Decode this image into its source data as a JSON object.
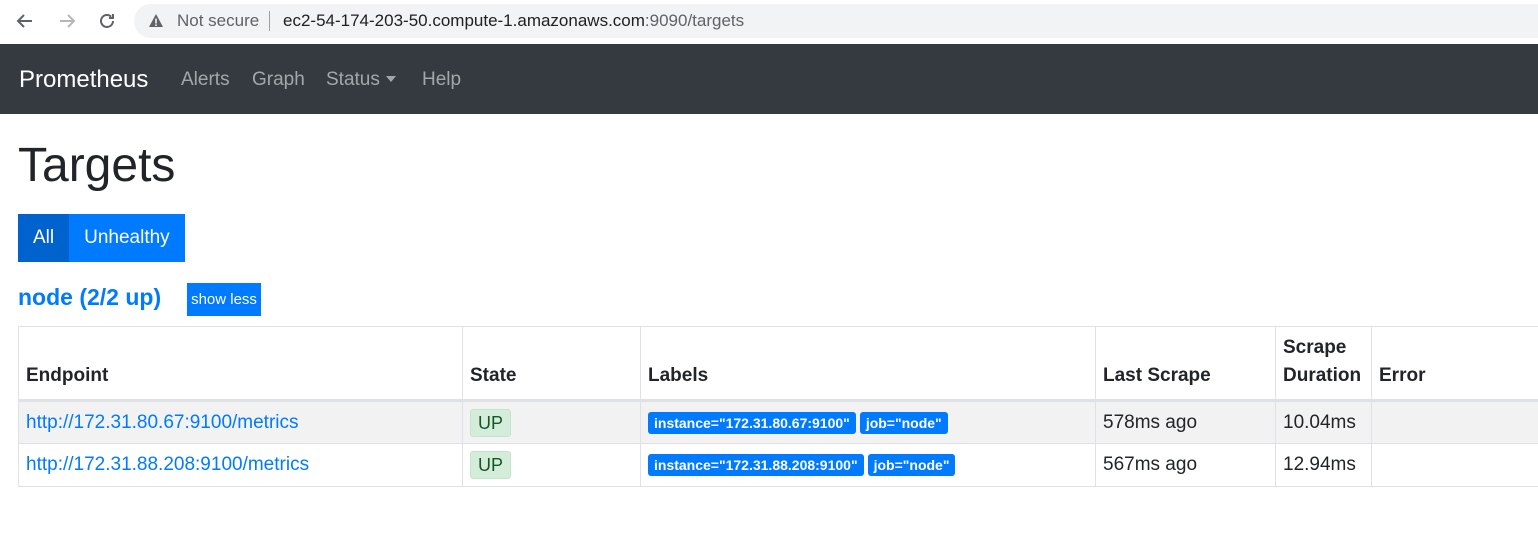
{
  "browser": {
    "security_text": "Not secure",
    "url_host": "ec2-54-174-203-50.compute-1.amazonaws.com",
    "url_path": ":9090/targets"
  },
  "navbar": {
    "brand": "Prometheus",
    "links": [
      "Alerts",
      "Graph",
      "Status",
      "Help"
    ]
  },
  "page": {
    "title": "Targets",
    "filter_buttons": [
      "All",
      "Unhealthy"
    ],
    "job_title": "node (2/2 up)",
    "toggle_label": "show less"
  },
  "table": {
    "headers": [
      "Endpoint",
      "State",
      "Labels",
      "Last Scrape",
      "Scrape Duration",
      "Error"
    ],
    "rows": [
      {
        "endpoint": "http://172.31.80.67:9100/metrics",
        "state": "UP",
        "labels": [
          "instance=\"172.31.80.67:9100\"",
          "job=\"node\""
        ],
        "last_scrape": "578ms ago",
        "duration": "10.04ms",
        "error": ""
      },
      {
        "endpoint": "http://172.31.88.208:9100/metrics",
        "state": "UP",
        "labels": [
          "instance=\"172.31.88.208:9100\"",
          "job=\"node\""
        ],
        "last_scrape": "567ms ago",
        "duration": "12.94ms",
        "error": ""
      }
    ]
  },
  "colors": {
    "primary": "#007bff",
    "navbar": "#343a40",
    "state_up_bg": "#d4edda"
  }
}
